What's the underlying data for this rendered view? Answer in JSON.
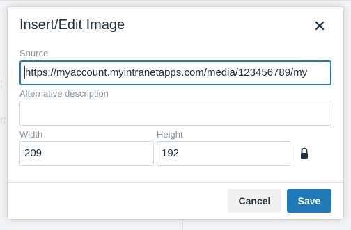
{
  "dialog": {
    "title": "Insert/Edit Image",
    "close_icon": "close-icon"
  },
  "fields": {
    "source": {
      "label": "Source",
      "value": "https://myaccount.myintranetapps.com/media/123456789/my"
    },
    "alt": {
      "label": "Alternative description",
      "value": ""
    },
    "width": {
      "label": "Width",
      "value": "209"
    },
    "height": {
      "label": "Height",
      "value": "192"
    },
    "constrain_icon": "lock-icon"
  },
  "buttons": {
    "cancel": "Cancel",
    "save": "Save"
  },
  "colors": {
    "primary": "#207ab7",
    "text": "#222f3e",
    "label": "#88929c"
  }
}
